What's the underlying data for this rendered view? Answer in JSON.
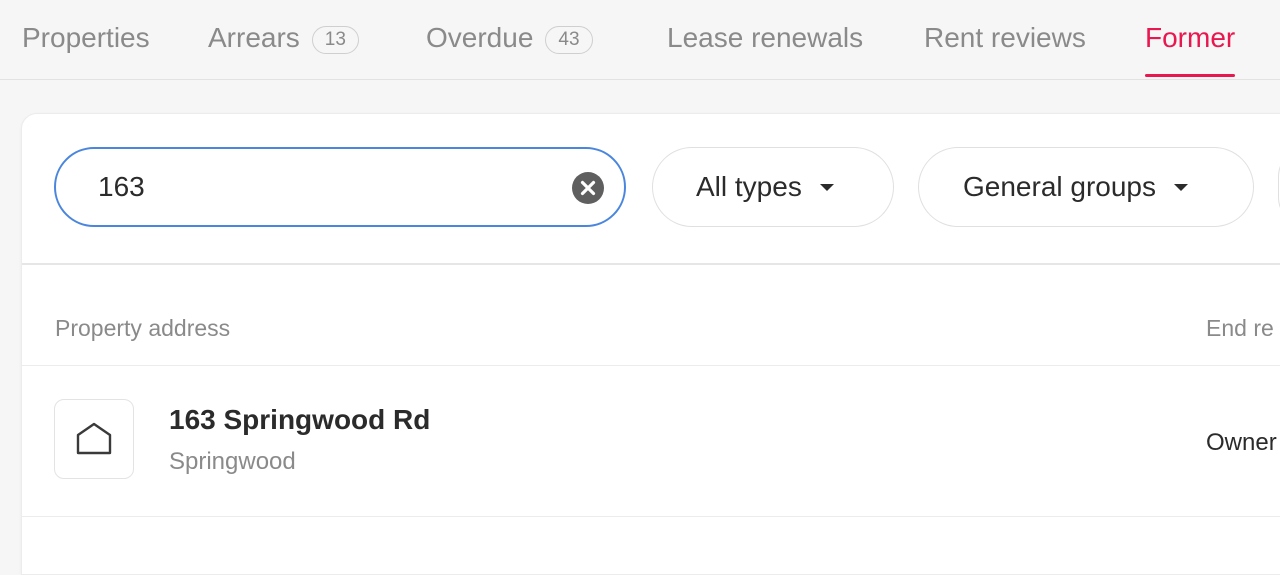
{
  "tabs": [
    {
      "label": "Properties",
      "badge": null,
      "active": false
    },
    {
      "label": "Arrears",
      "badge": "13",
      "active": false
    },
    {
      "label": "Overdue",
      "badge": "43",
      "active": false
    },
    {
      "label": "Lease renewals",
      "badge": null,
      "active": false
    },
    {
      "label": "Rent reviews",
      "badge": null,
      "active": false
    },
    {
      "label": "Former",
      "badge": null,
      "active": true
    }
  ],
  "filters": {
    "search_value": "163",
    "types_label": "All types",
    "groups_label": "General groups"
  },
  "table": {
    "columns": {
      "address": "Property address",
      "end_reason": "End re"
    },
    "rows": [
      {
        "title": "163 Springwood Rd",
        "suburb": "Springwood",
        "end_reason": "Owner"
      }
    ]
  },
  "colors": {
    "accent": "#e8174f",
    "focus": "#4a86dd",
    "muted": "#8a8a8a"
  },
  "icons": [
    "close-icon",
    "chevron-down-icon",
    "house-icon"
  ]
}
